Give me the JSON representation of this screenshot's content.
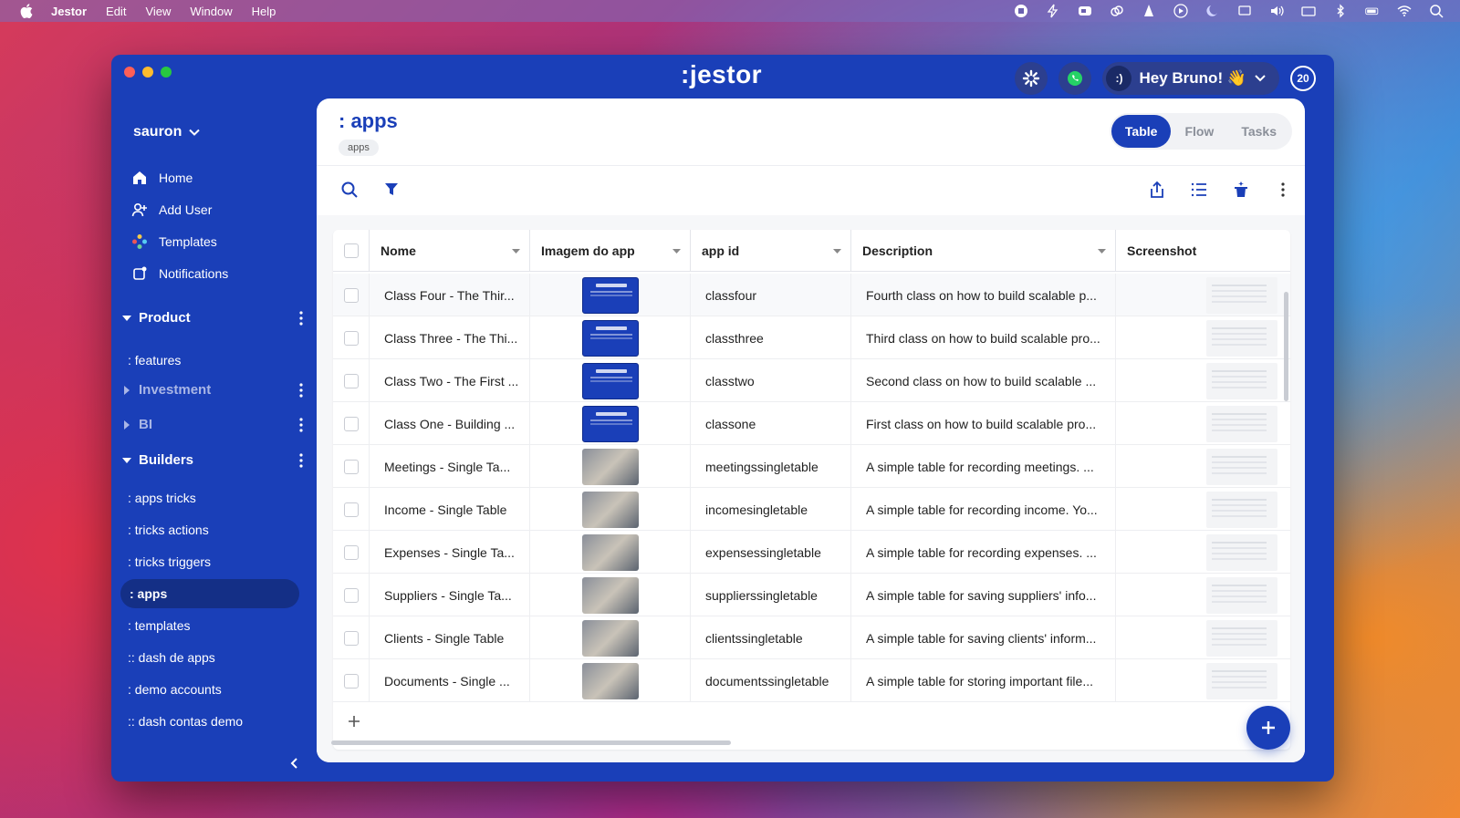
{
  "menubar": {
    "items": [
      "Jestor",
      "Edit",
      "View",
      "Window",
      "Help"
    ]
  },
  "header": {
    "logo": ":jestor",
    "greeting": "Hey Bruno! 👋",
    "avatar_text": ":)",
    "notification_count": "20"
  },
  "sidebar": {
    "workspace": "sauron",
    "nav": [
      {
        "label": "Home",
        "icon": "home-icon"
      },
      {
        "label": "Add User",
        "icon": "add-user-icon"
      },
      {
        "label": "Templates",
        "icon": "templates-icon"
      },
      {
        "label": "Notifications",
        "icon": "notifications-icon"
      }
    ],
    "groups": {
      "product": "Product",
      "investment": "Investment",
      "bi": "BI",
      "builders": "Builders"
    },
    "product_items": [
      ": features"
    ],
    "builders_items": [
      ": apps tricks",
      ": tricks actions",
      ": tricks triggers",
      ": apps",
      ": templates",
      ":: dash de apps",
      ": demo accounts",
      ":: dash contas demo"
    ]
  },
  "page": {
    "title": ": apps",
    "breadcrumb": "apps",
    "views": [
      "Table",
      "Flow",
      "Tasks"
    ],
    "active_view": "Table"
  },
  "table": {
    "columns": [
      "Nome",
      "Imagem do app",
      "app id",
      "Description",
      "Screenshot"
    ],
    "rows": [
      {
        "nome": "Class Four - The Thir...",
        "image": "blue",
        "app_id": "classfour",
        "description": "Fourth class on how to build scalable p..."
      },
      {
        "nome": "Class Three - The Thi...",
        "image": "blue",
        "app_id": "classthree",
        "description": "Third class on how to build scalable pro..."
      },
      {
        "nome": "Class Two - The First ...",
        "image": "blue",
        "app_id": "classtwo",
        "description": "Second class on how to build scalable ..."
      },
      {
        "nome": "Class One - Building ...",
        "image": "blue",
        "app_id": "classone",
        "description": "First class on how to build scalable pro..."
      },
      {
        "nome": "Meetings - Single Ta...",
        "image": "photo",
        "app_id": "meetingssingletable",
        "description": "A simple table for recording meetings. ..."
      },
      {
        "nome": "Income - Single Table",
        "image": "photo",
        "app_id": "incomesingletable",
        "description": "A simple table for recording income. Yo..."
      },
      {
        "nome": "Expenses - Single Ta...",
        "image": "photo",
        "app_id": "expensessingletable",
        "description": "A simple table for recording expenses. ..."
      },
      {
        "nome": "Suppliers - Single Ta...",
        "image": "photo",
        "app_id": "supplierssingletable",
        "description": "A simple table for saving suppliers' info..."
      },
      {
        "nome": "Clients - Single Table",
        "image": "photo",
        "app_id": "clientssingletable",
        "description": "A simple table for saving clients' inform..."
      },
      {
        "nome": "Documents - Single ...",
        "image": "photo",
        "app_id": "documentssingletable",
        "description": "A simple table for storing important file..."
      }
    ]
  },
  "colors": {
    "brand": "#1a3fb8",
    "sidebar_active": "#142f86"
  }
}
